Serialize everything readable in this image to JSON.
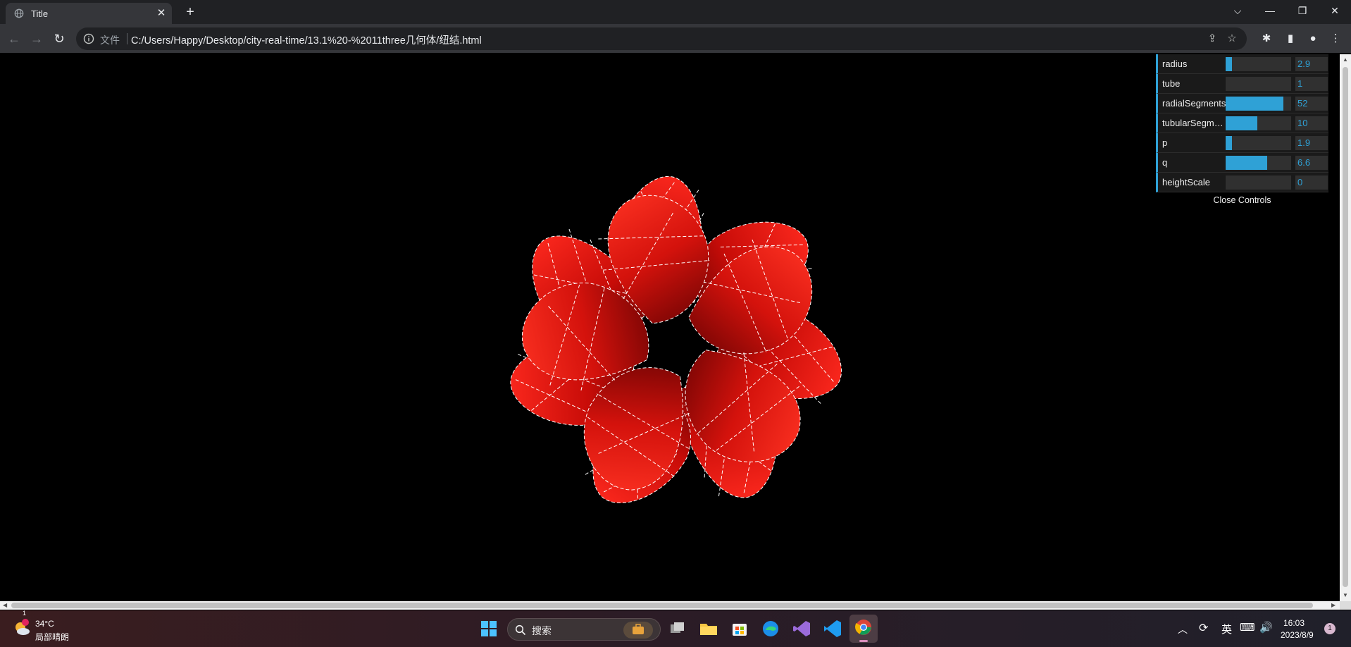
{
  "browser": {
    "tab_title": "Title",
    "address_scheme": "文件",
    "address_url": "C:/Users/Happy/Desktop/city-real-time/13.1%20-%2011three几何体/纽结.html"
  },
  "gui": {
    "controls": [
      {
        "label": "radius",
        "value": "2.9",
        "fill": 0.1
      },
      {
        "label": "tube",
        "value": "1",
        "fill": 0.0
      },
      {
        "label": "radialSegments",
        "value": "52",
        "fill": 0.88
      },
      {
        "label": "tubularSegments",
        "value": "10",
        "fill": 0.48
      },
      {
        "label": "p",
        "value": "1.9",
        "fill": 0.1
      },
      {
        "label": "q",
        "value": "6.6",
        "fill": 0.63
      },
      {
        "label": "heightScale",
        "value": "0",
        "fill": 0.0
      }
    ],
    "close_label": "Close Controls",
    "accent": "#2fa1d6"
  },
  "taskbar": {
    "weather_temp": "34°C",
    "weather_desc": "局部晴朗",
    "weather_badge": "1",
    "search_label": "搜索",
    "ime": "英",
    "time": "16:03",
    "date": "2023/8/9",
    "notification_count": "1"
  }
}
